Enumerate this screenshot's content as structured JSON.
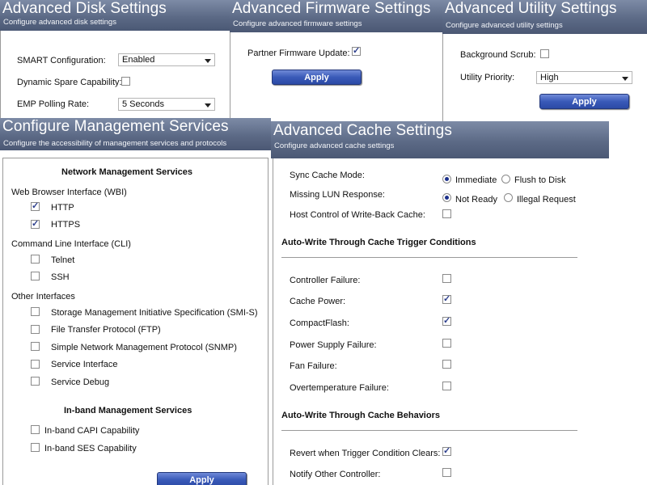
{
  "disk": {
    "title": "Advanced Disk Settings",
    "subtitle": "Configure advanced disk settings",
    "smart_label": "SMART Configuration:",
    "smart_value": "Enabled",
    "dynamic_spare_label": "Dynamic Spare Capability:",
    "dynamic_spare_checked": false,
    "emp_label": "EMP Polling Rate:",
    "emp_value": "5 Seconds"
  },
  "firmware": {
    "title": "Advanced Firmware Settings",
    "subtitle": "Configure advanced firmware settings",
    "partner_label": "Partner Firmware Update:",
    "partner_checked": true,
    "apply_label": "Apply"
  },
  "utility": {
    "title": "Advanced Utility Settings",
    "subtitle": "Configure advanced utility settings",
    "scrub_label": "Background Scrub:",
    "scrub_checked": false,
    "priority_label": "Utility Priority:",
    "priority_value": "High",
    "apply_label": "Apply"
  },
  "mgmt": {
    "title": "Configure Management Services",
    "subtitle": "Configure the accessibility of management services and protocols",
    "network_heading": "Network Management Services",
    "wbi_group": "Web Browser Interface (WBI)",
    "http_label": "HTTP",
    "https_label": "HTTPS",
    "cli_group": "Command Line Interface (CLI)",
    "telnet_label": "Telnet",
    "ssh_label": "SSH",
    "other_group": "Other Interfaces",
    "smis_label": "Storage Management Initiative Specification (SMI-S)",
    "ftp_label": "File Transfer Protocol (FTP)",
    "snmp_label": "Simple Network Management Protocol (SNMP)",
    "service_interface_label": "Service Interface",
    "service_debug_label": "Service Debug",
    "inband_heading": "In-band Management Services",
    "capi_label": "In-band CAPI Capability",
    "ses_label": "In-band SES Capability",
    "apply_label": "Apply"
  },
  "cache": {
    "title": "Advanced Cache Settings",
    "subtitle": "Configure advanced cache settings",
    "sync_label": "Sync Cache Mode:",
    "sync_opt1": "Immediate",
    "sync_opt2": "Flush to Disk",
    "sync_selected": "Immediate",
    "missing_lun_label": "Missing LUN Response:",
    "lun_opt1": "Not Ready",
    "lun_opt2": "Illegal Request",
    "lun_selected": "Not Ready",
    "host_control_label": "Host Control of Write-Back Cache:",
    "trigger_heading": "Auto-Write Through Cache Trigger Conditions",
    "controller_failure_label": "Controller Failure:",
    "cache_power_label": "Cache Power:",
    "compactflash_label": "CompactFlash:",
    "psu_failure_label": "Power Supply Failure:",
    "fan_failure_label": "Fan Failure:",
    "overtemp_label": "Overtemperature Failure:",
    "behaviors_heading": "Auto-Write Through Cache Behaviors",
    "revert_label": "Revert when Trigger Condition Clears:",
    "notify_label": "Notify Other Controller:"
  }
}
